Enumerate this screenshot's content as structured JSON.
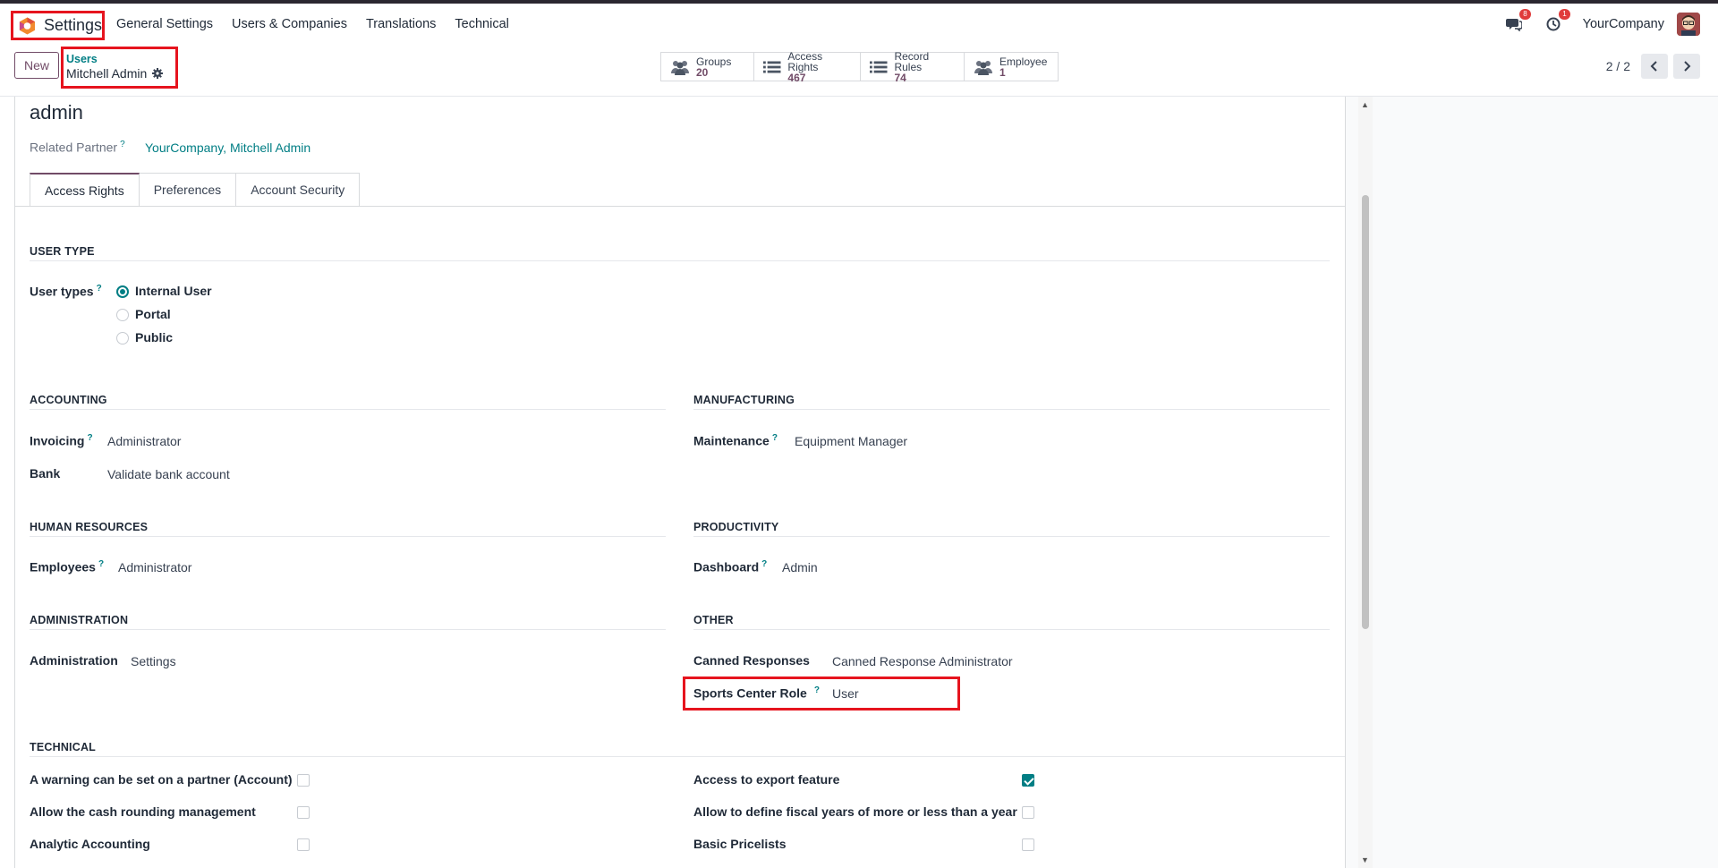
{
  "navbar": {
    "app_name": "Settings",
    "menu": [
      "General Settings",
      "Users & Companies",
      "Translations",
      "Technical"
    ],
    "messages_badge": "8",
    "activity_badge": "1",
    "company": "YourCompany"
  },
  "control": {
    "new_label": "New",
    "breadcrumb_parent": "Users",
    "breadcrumb_current": "Mitchell Admin",
    "smart_buttons": [
      {
        "label": "Groups",
        "value": "20"
      },
      {
        "label": "Access Rights",
        "value": "467"
      },
      {
        "label": "Record Rules",
        "value": "74"
      },
      {
        "label": "Employee",
        "value": "1"
      }
    ],
    "pager": "2 / 2"
  },
  "form": {
    "login": "admin",
    "related_partner_label": "Related Partner",
    "related_partner_value": "YourCompany, Mitchell Admin",
    "tabs": [
      "Access Rights",
      "Preferences",
      "Account Security"
    ],
    "user_type": {
      "section": "USER TYPE",
      "label": "User types",
      "options": [
        "Internal User",
        "Portal",
        "Public"
      ],
      "selected": "Internal User"
    },
    "accounting": {
      "section": "ACCOUNTING",
      "invoicing_label": "Invoicing",
      "invoicing_value": "Administrator",
      "bank_label": "Bank",
      "bank_value": "Validate bank account"
    },
    "manufacturing": {
      "section": "MANUFACTURING",
      "maintenance_label": "Maintenance",
      "maintenance_value": "Equipment Manager"
    },
    "human_resources": {
      "section": "HUMAN RESOURCES",
      "employees_label": "Employees",
      "employees_value": "Administrator"
    },
    "productivity": {
      "section": "PRODUCTIVITY",
      "dashboard_label": "Dashboard",
      "dashboard_value": "Admin"
    },
    "administration": {
      "section": "ADMINISTRATION",
      "administration_label": "Administration",
      "administration_value": "Settings"
    },
    "other": {
      "section": "OTHER",
      "canned_label": "Canned Responses",
      "canned_value": "Canned Response Administrator",
      "sports_label": "Sports Center Role",
      "sports_value": "User"
    },
    "technical": {
      "section": "TECHNICAL",
      "left": [
        {
          "label": "A warning can be set on a partner (Account)",
          "checked": false
        },
        {
          "label": "Allow the cash rounding management",
          "checked": false
        },
        {
          "label": "Analytic Accounting",
          "checked": false
        }
      ],
      "right": [
        {
          "label": "Access to export feature",
          "checked": true
        },
        {
          "label": "Allow to define fiscal years of more or less than a year",
          "checked": false
        },
        {
          "label": "Basic Pricelists",
          "checked": false
        }
      ]
    }
  }
}
